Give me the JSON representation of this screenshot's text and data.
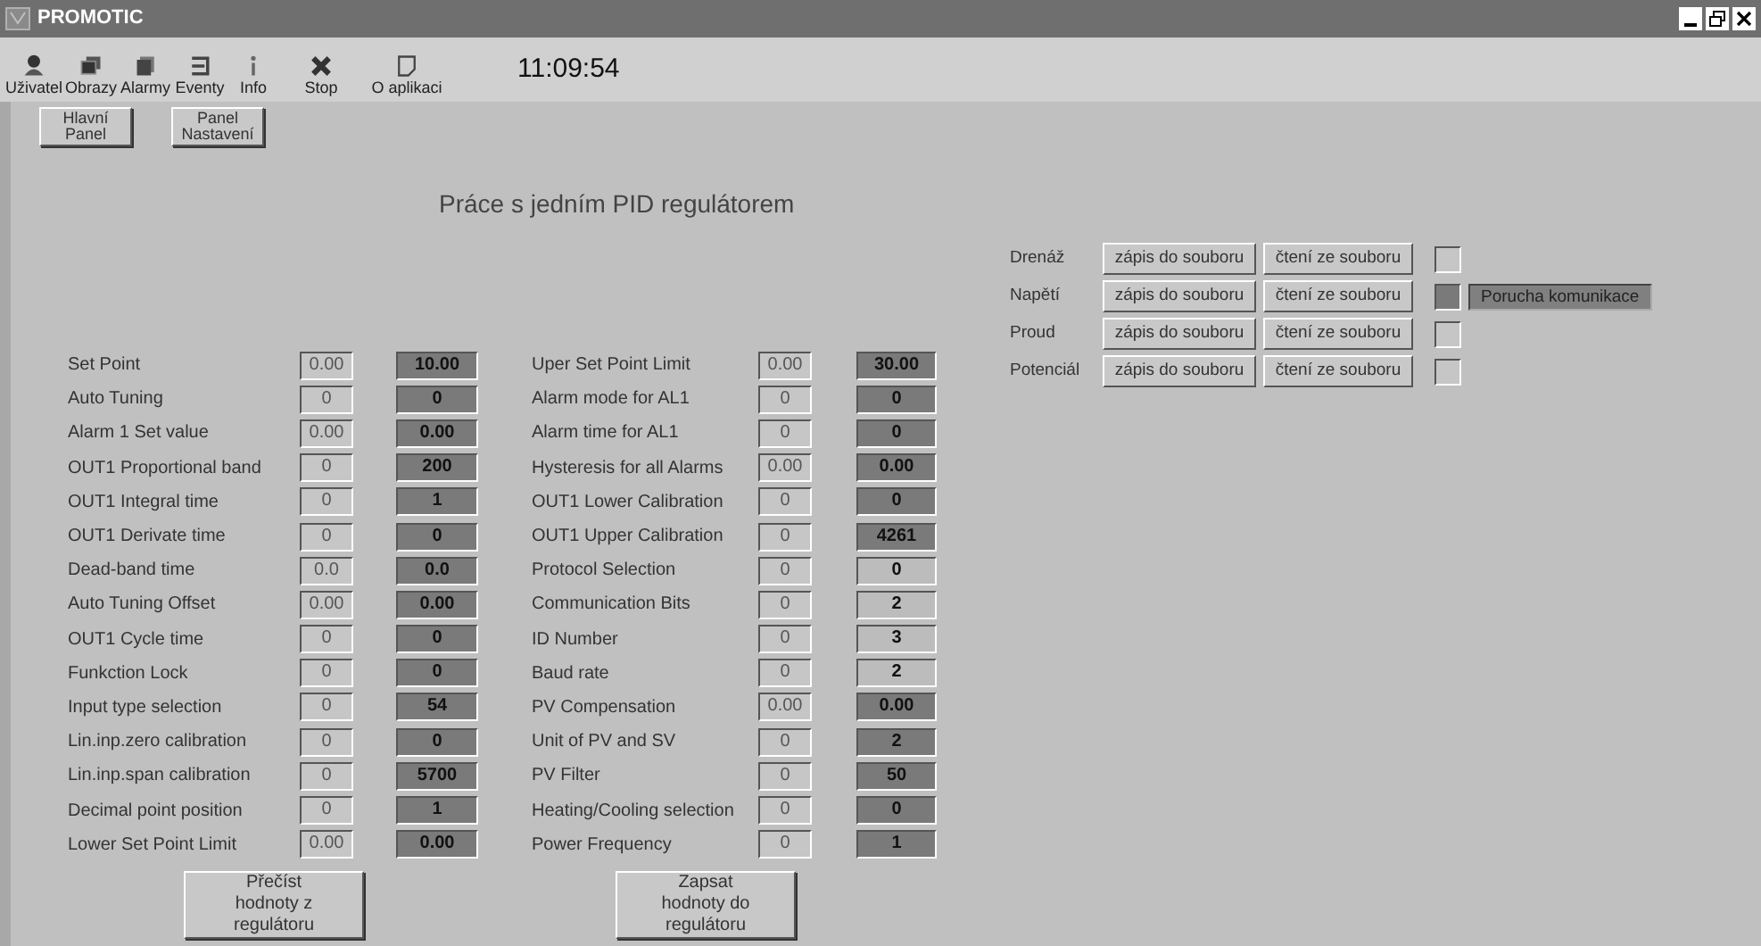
{
  "window": {
    "title": "PROMOTIC"
  },
  "toolbar": [
    {
      "kind": "user",
      "label": "Uživatel"
    },
    {
      "kind": "views",
      "label": "Obrazy"
    },
    {
      "kind": "alarms",
      "label": "Alarmy"
    },
    {
      "kind": "events",
      "label": "Eventy"
    },
    {
      "kind": "info",
      "label": "Info"
    },
    {
      "kind": "stop",
      "label": "Stop"
    },
    {
      "kind": "about",
      "label": "O aplikaci"
    }
  ],
  "clock": "11:09:54",
  "nav_buttons": [
    "Hlavní Panel",
    "Panel Nastavení"
  ],
  "heading": "Práce s jedním PID regulátorem",
  "parameters": [
    [
      {
        "label": "Set Point",
        "read": "0.00",
        "set": "10.00",
        "highlighted": true
      },
      {
        "label": "Auto Tuning",
        "read": "0",
        "set": "0",
        "highlighted": true
      },
      {
        "label": "Alarm 1 Set value",
        "read": "0.00",
        "set": "0.00",
        "highlighted": true
      },
      {
        "label": "OUT1 Proportional band",
        "read": "0",
        "set": "200",
        "highlighted": true
      },
      {
        "label": "OUT1 Integral time",
        "read": "0",
        "set": "1",
        "highlighted": true
      },
      {
        "label": "OUT1 Derivate time",
        "read": "0",
        "set": "0",
        "highlighted": true
      },
      {
        "label": "Dead-band time",
        "read": "0.0",
        "set": "0.0",
        "highlighted": true
      },
      {
        "label": "Auto Tuning Offset",
        "read": "0.00",
        "set": "0.00",
        "highlighted": true
      },
      {
        "label": "OUT1 Cycle time",
        "read": "0",
        "set": "0",
        "highlighted": true
      },
      {
        "label": "Funkction Lock",
        "read": "0",
        "set": "0",
        "highlighted": true
      },
      {
        "label": "Input type selection",
        "read": "0",
        "set": "54",
        "highlighted": true
      },
      {
        "label": "Lin.inp.zero calibration",
        "read": "0",
        "set": "0",
        "highlighted": true
      },
      {
        "label": "Lin.inp.span calibration",
        "read": "0",
        "set": "5700",
        "highlighted": true
      },
      {
        "label": "Decimal point position",
        "read": "0",
        "set": "1",
        "highlighted": true
      },
      {
        "label": "Lower Set Point Limit",
        "read": "0.00",
        "set": "0.00",
        "highlighted": true
      }
    ],
    [
      {
        "label": "Uper Set Point Limit",
        "read": "0.00",
        "set": "30.00",
        "highlighted": true
      },
      {
        "label": "Alarm mode for AL1",
        "read": "0",
        "set": "0",
        "highlighted": true
      },
      {
        "label": "Alarm time for AL1",
        "read": "0",
        "set": "0",
        "highlighted": true
      },
      {
        "label": "Hysteresis for all Alarms",
        "read": "0.00",
        "set": "0.00",
        "highlighted": true
      },
      {
        "label": "OUT1 Lower Calibration",
        "read": "0",
        "set": "0",
        "highlighted": true
      },
      {
        "label": "OUT1 Upper Calibration",
        "read": "0",
        "set": "4261",
        "highlighted": true
      },
      {
        "label": "Protocol Selection",
        "read": "0",
        "set": "0",
        "highlighted": false
      },
      {
        "label": "Communication Bits",
        "read": "0",
        "set": "2",
        "highlighted": false
      },
      {
        "label": "ID Number",
        "read": "0",
        "set": "3",
        "highlighted": false
      },
      {
        "label": "Baud rate",
        "read": "0",
        "set": "2",
        "highlighted": false
      },
      {
        "label": "PV Compensation",
        "read": "0.00",
        "set": "0.00",
        "highlighted": true
      },
      {
        "label": "Unit of PV and SV",
        "read": "0",
        "set": "2",
        "highlighted": true
      },
      {
        "label": "PV Filter",
        "read": "0",
        "set": "50",
        "highlighted": true
      },
      {
        "label": "Heating/Cooling selection",
        "read": "0",
        "set": "0",
        "highlighted": true
      },
      {
        "label": "Power Frequency",
        "read": "0",
        "set": "1",
        "highlighted": true
      }
    ]
  ],
  "channels": [
    {
      "label": "Drenáž",
      "write_button": "zápis do souboru",
      "read_button": "čtení ze souboru",
      "fault": false
    },
    {
      "label": "Napětí",
      "write_button": "zápis do souboru",
      "read_button": "čtení ze souboru",
      "fault": true,
      "status": "Porucha komunikace"
    },
    {
      "label": "Proud",
      "write_button": "zápis do souboru",
      "read_button": "čtení ze souboru",
      "fault": false
    },
    {
      "label": "Potenciál",
      "write_button": "zápis do souboru",
      "read_button": "čtení ze souboru",
      "fault": false
    }
  ],
  "action_buttons": [
    "Přečíst hodnoty z regulátoru",
    "Zapsat hodnoty do regulátoru"
  ]
}
